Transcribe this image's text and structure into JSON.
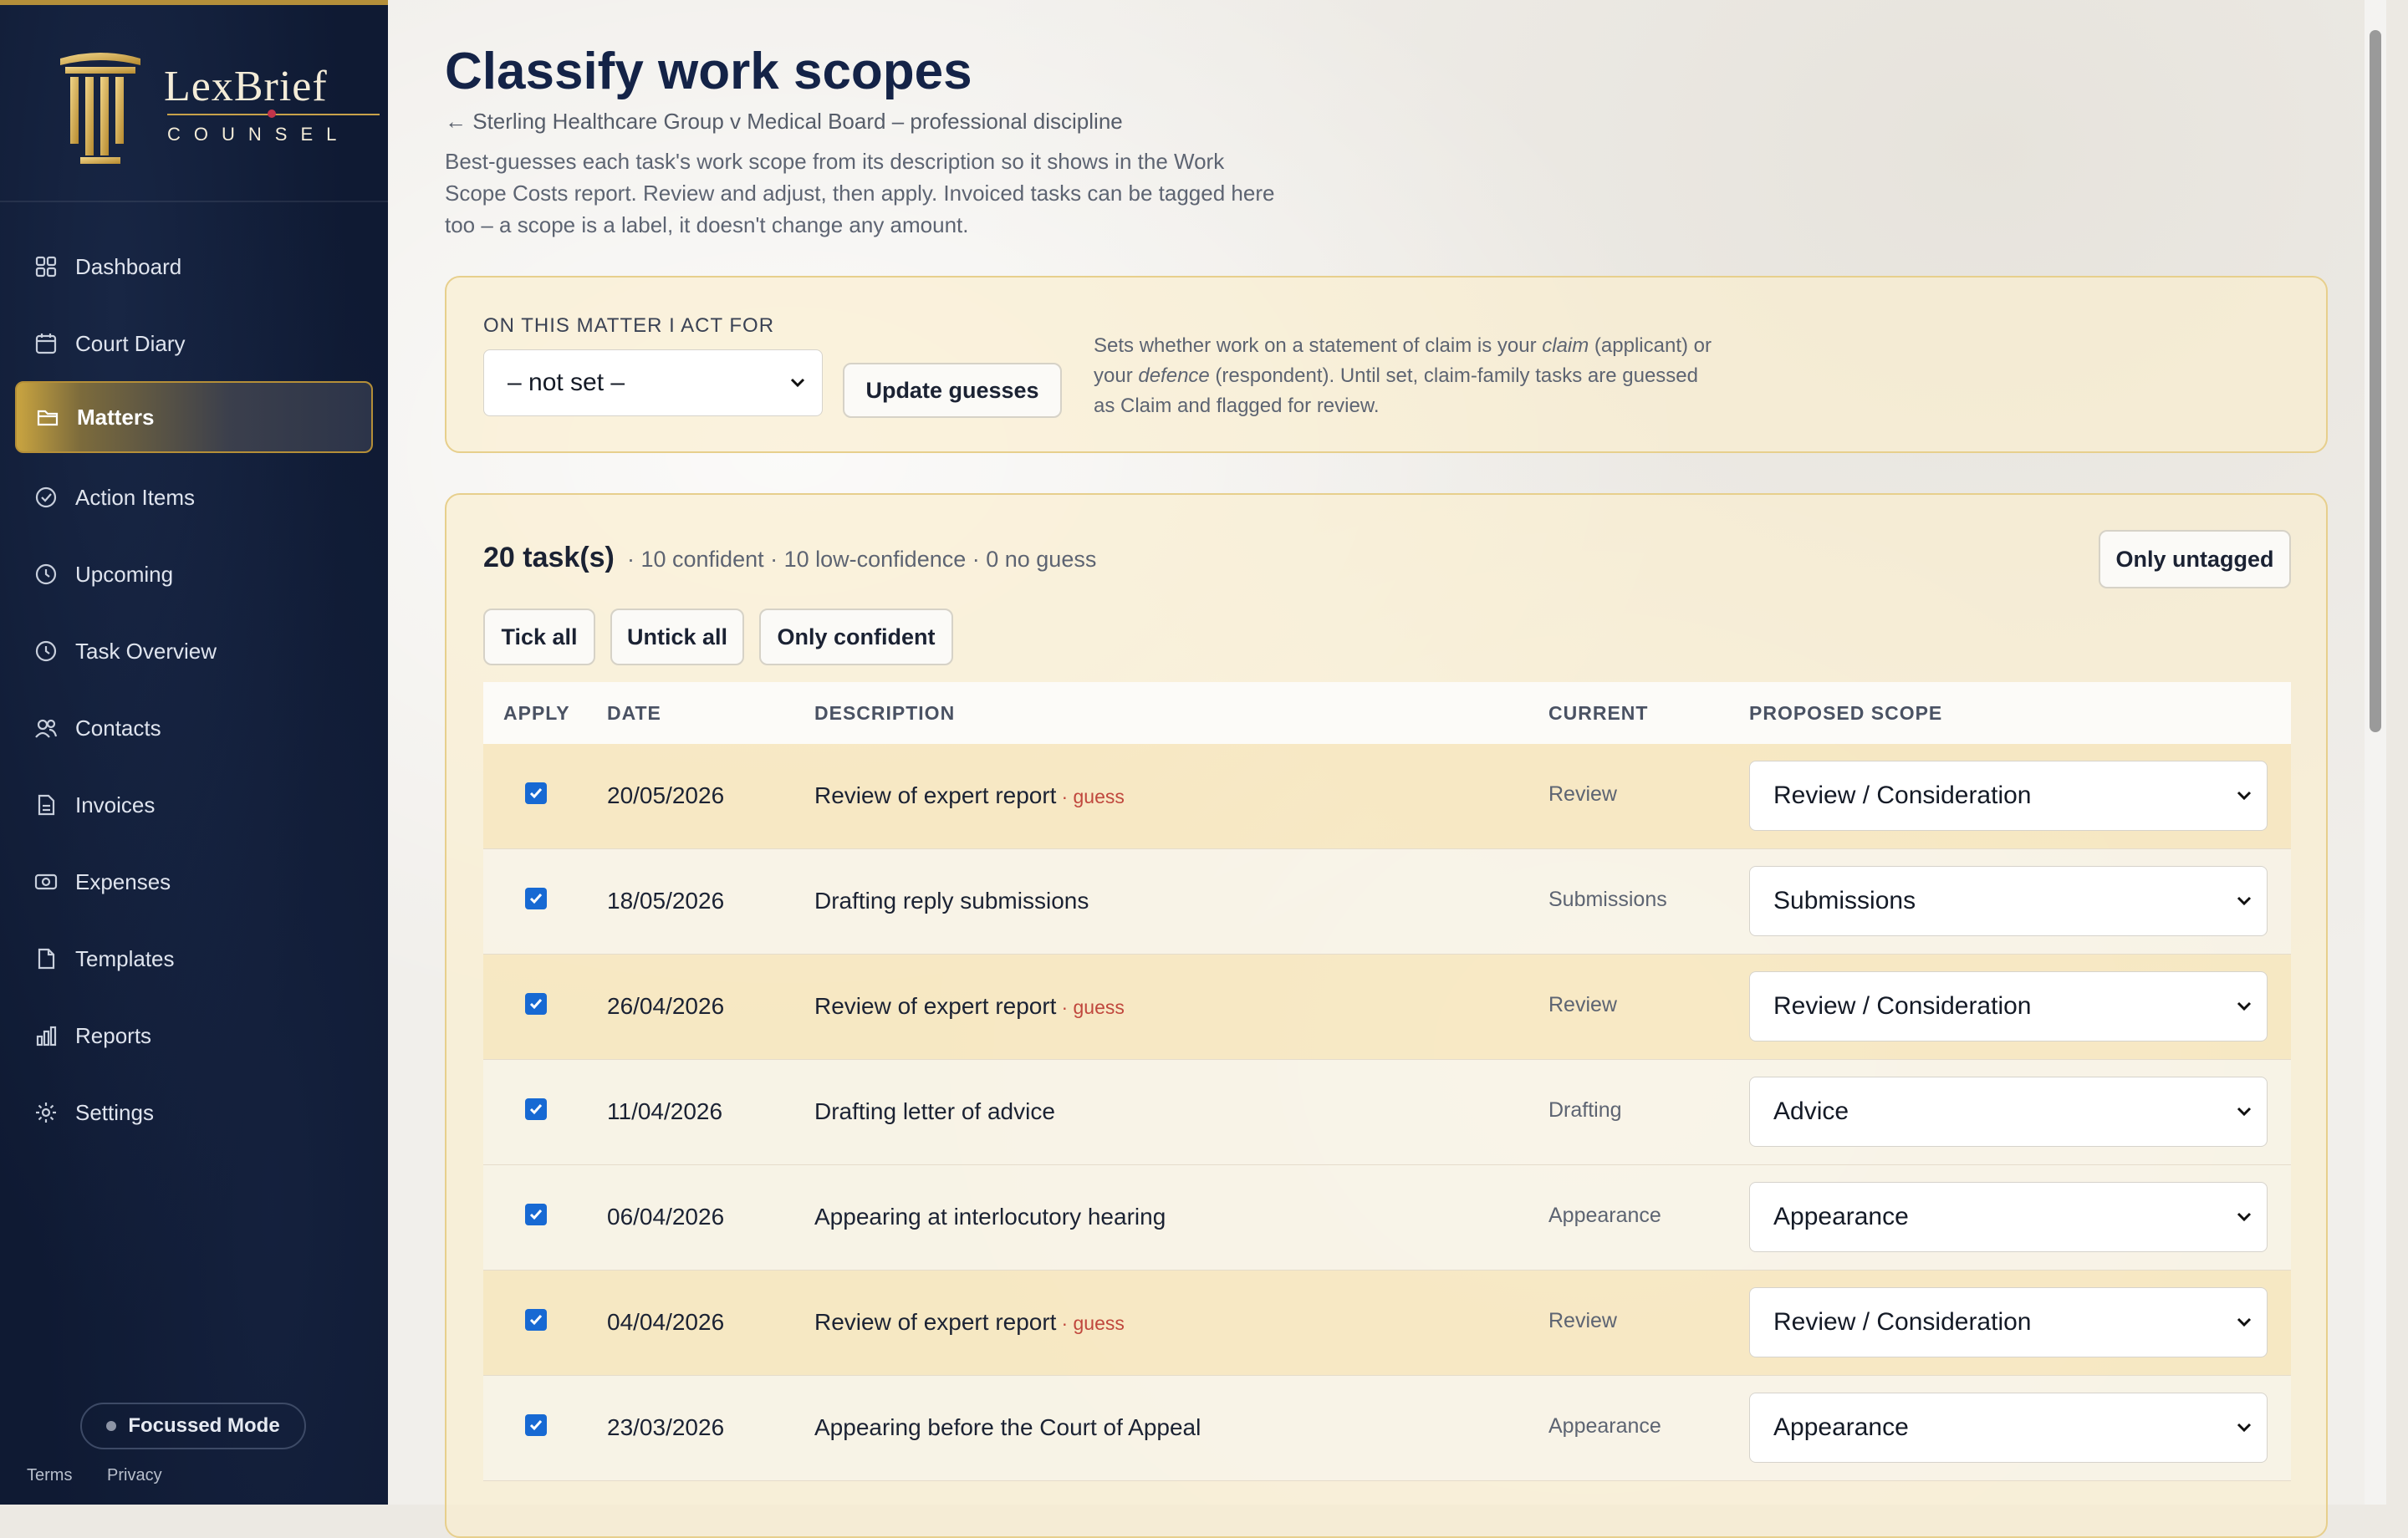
{
  "brand": {
    "name": "LexBrief",
    "sub": "COUNSEL"
  },
  "sidebar": {
    "items": [
      {
        "label": "Dashboard",
        "icon": "grid-icon"
      },
      {
        "label": "Court Diary",
        "icon": "calendar-icon"
      },
      {
        "label": "Matters",
        "icon": "folder-icon",
        "active": true
      },
      {
        "label": "Action Items",
        "icon": "check-circle-icon"
      },
      {
        "label": "Upcoming",
        "icon": "clock-icon"
      },
      {
        "label": "Task Overview",
        "icon": "clock-icon"
      },
      {
        "label": "Contacts",
        "icon": "people-icon"
      },
      {
        "label": "Invoices",
        "icon": "document-icon"
      },
      {
        "label": "Expenses",
        "icon": "cash-icon"
      },
      {
        "label": "Templates",
        "icon": "document-icon"
      },
      {
        "label": "Reports",
        "icon": "bar-chart-icon"
      },
      {
        "label": "Settings",
        "icon": "gear-icon"
      }
    ],
    "focus_mode": "Focussed Mode",
    "footer": {
      "terms": "Terms",
      "privacy": "Privacy"
    }
  },
  "page": {
    "title": "Classify work scopes",
    "back": "← Sterling Healthcare Group v Medical Board – professional discipline",
    "intro": "Best-guesses each task's work scope from its description so it shows in the Work Scope Costs report. Review and adjust, then apply. Invoiced tasks can be tagged here too – a scope is a label, it doesn't change any amount."
  },
  "act_for": {
    "label": "ON THIS MATTER I ACT FOR",
    "selected": "– not set –",
    "update_button": "Update guesses",
    "help_pre": "Sets whether work on a statement of claim is your ",
    "help_claim": "claim",
    "help_mid": " (applicant) or your ",
    "help_defence": "defence",
    "help_post": " (respondent). Until set, claim-family tasks are guessed as Claim and flagged for review."
  },
  "tasks": {
    "count": "20 task(s)",
    "summary": "· 10 confident · 10 low-confidence · 0 no guess",
    "only_untagged": "Only untagged",
    "tick_all": "Tick all",
    "untick_all": "Untick all",
    "only_confident": "Only confident",
    "headers": {
      "apply": "APPLY",
      "date": "DATE",
      "description": "DESCRIPTION",
      "current": "CURRENT",
      "proposed": "PROPOSED SCOPE"
    },
    "guess_label": "· guess",
    "rows": [
      {
        "date": "20/05/2026",
        "description": "Review of expert report",
        "guess": true,
        "current": "Review",
        "proposed": "Review / Consideration"
      },
      {
        "date": "18/05/2026",
        "description": "Drafting reply submissions",
        "guess": false,
        "current": "Submissions",
        "proposed": "Submissions"
      },
      {
        "date": "26/04/2026",
        "description": "Review of expert report",
        "guess": true,
        "current": "Review",
        "proposed": "Review / Consideration"
      },
      {
        "date": "11/04/2026",
        "description": "Drafting letter of advice",
        "guess": false,
        "current": "Drafting",
        "proposed": "Advice"
      },
      {
        "date": "06/04/2026",
        "description": "Appearing at interlocutory hearing",
        "guess": false,
        "current": "Appearance",
        "proposed": "Appearance"
      },
      {
        "date": "04/04/2026",
        "description": "Review of expert report",
        "guess": true,
        "current": "Review",
        "proposed": "Review / Consideration"
      },
      {
        "date": "23/03/2026",
        "description": "Appearing before the Court of Appeal",
        "guess": false,
        "current": "Appearance",
        "proposed": "Appearance"
      }
    ]
  }
}
